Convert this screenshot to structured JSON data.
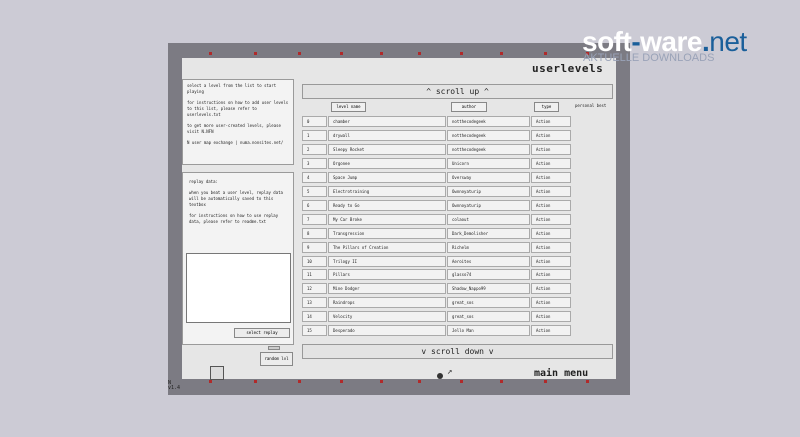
{
  "header": {
    "title": "userlevels"
  },
  "info_panel": {
    "lines": [
      "select a level from the list to start playing",
      "for instructions on how to add user levels to this list, please refer to userlevels.txt",
      "to get more user-created levels, please visit N.NFN",
      "N user map exchange | numa.nonsites.net/"
    ]
  },
  "replay_panel": {
    "title": "replay data:",
    "text1": "when you beat a user level, replay data will be automatically saved to this textbox",
    "text2": "for instructions on how to use replay data, please refer to readme.txt",
    "select_button": "select replay",
    "random_button": "random lvl"
  },
  "version": "N\nv1.4",
  "scroll_up": "^   scroll up   ^",
  "scroll_down": "v   scroll down   v",
  "columns": {
    "name": "level name",
    "author": "author",
    "type": "type",
    "personal_best": "personal best"
  },
  "levels": [
    {
      "num": "0",
      "name": "chamber",
      "author": "notthecodegeek",
      "type": "Action"
    },
    {
      "num": "1",
      "name": "drywall",
      "author": "notthecodegeek",
      "type": "Action"
    },
    {
      "num": "2",
      "name": "Sleepy Rocket",
      "author": "notthecodegeek",
      "type": "Action"
    },
    {
      "num": "3",
      "name": "Orgonee",
      "author": "Unicorn",
      "type": "Action"
    },
    {
      "num": "4",
      "name": "Space Jump",
      "author": "Oversway",
      "type": "Action"
    },
    {
      "num": "5",
      "name": "Electrotraining",
      "author": "Ownnoyaturip",
      "type": "Action"
    },
    {
      "num": "6",
      "name": "Ready to Go",
      "author": "Ownnoyaturip",
      "type": "Action"
    },
    {
      "num": "7",
      "name": "My Car Broke",
      "author": "colaout",
      "type": "Action"
    },
    {
      "num": "8",
      "name": "Transgression",
      "author": "Dark_Demolisher",
      "type": "Action"
    },
    {
      "num": "9",
      "name": "The Pillars of Creation",
      "author": "Richelm",
      "type": "Action"
    },
    {
      "num": "10",
      "name": "Trilogy II",
      "author": "Aeroites",
      "type": "Action"
    },
    {
      "num": "11",
      "name": "Pillars",
      "author": "glasso74",
      "type": "Action"
    },
    {
      "num": "12",
      "name": "Mine Dodger",
      "author": "Shadow_Nappo99",
      "type": "Action"
    },
    {
      "num": "13",
      "name": "Raindrops",
      "author": "great_sos",
      "type": "Action"
    },
    {
      "num": "14",
      "name": "Velocity",
      "author": "great_sos",
      "type": "Action"
    },
    {
      "num": "15",
      "name": "Desperado",
      "author": "Jello Man",
      "type": "Action"
    }
  ],
  "main_menu": "main menu",
  "watermark": {
    "main_a": "soft",
    "dash": "-",
    "main_b": "ware",
    "dot": ".",
    "tld": "net",
    "sub": "AKTUELLE DOWNLOADS"
  },
  "colors": {
    "frame": "#7c7b83",
    "stage": "#e6e6e6",
    "background": "#cccbd5",
    "logo_blue": "#1a5f9a"
  }
}
